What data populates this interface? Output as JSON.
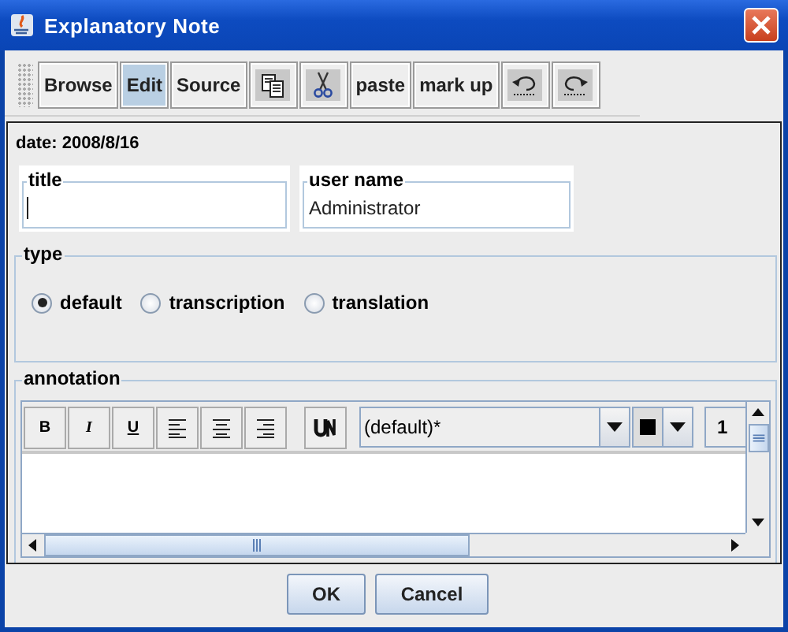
{
  "window": {
    "title": "Explanatory Note"
  },
  "toolbar": [
    {
      "kind": "text",
      "label": "Browse",
      "selected": false
    },
    {
      "kind": "text",
      "label": "Edit",
      "selected": true
    },
    {
      "kind": "text",
      "label": "Source",
      "selected": false
    },
    {
      "kind": "copy",
      "selected": false
    },
    {
      "kind": "cut",
      "selected": false
    },
    {
      "kind": "text",
      "label": "paste",
      "selected": false
    },
    {
      "kind": "text",
      "label": "mark up",
      "selected": false
    },
    {
      "kind": "undo",
      "selected": false
    },
    {
      "kind": "redo",
      "selected": false
    }
  ],
  "date": "date: 2008/8/16",
  "fields": [
    {
      "label": "title"
    },
    {
      "label": "user name",
      "value": "Administrator"
    }
  ],
  "type": {
    "label": "type",
    "options": [
      {
        "label": "default",
        "selected": true
      },
      {
        "label": "transcription",
        "selected": false
      },
      {
        "label": "translation",
        "selected": false
      }
    ]
  },
  "annotation": {
    "label": "annotation",
    "format_buttons": [
      {
        "kind": "bold",
        "label": "B"
      },
      {
        "kind": "italic",
        "label": "I"
      },
      {
        "kind": "underline",
        "label": "U"
      },
      {
        "kind": "align-left"
      },
      {
        "kind": "align-center"
      },
      {
        "kind": "align-right"
      }
    ],
    "font": "(default)*",
    "size": "1"
  },
  "buttons": [
    "OK",
    "Cancel"
  ]
}
